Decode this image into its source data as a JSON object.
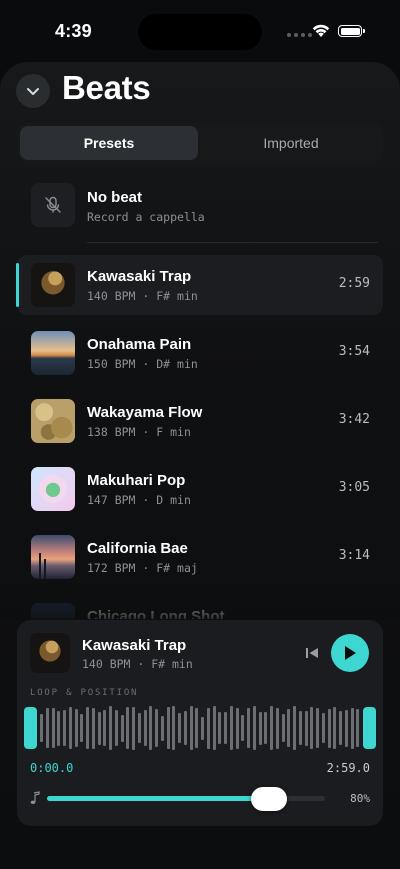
{
  "status_bar": {
    "time": "4:39"
  },
  "header": {
    "title": "Beats"
  },
  "tabs": [
    {
      "label": "Presets",
      "active": true
    },
    {
      "label": "Imported",
      "active": false
    }
  ],
  "no_beat": {
    "title": "No beat",
    "subtitle": "Record a cappella",
    "icon": "mic-off-icon"
  },
  "tracks": [
    {
      "title": "Kawasaki Trap",
      "bpm": "140 BPM",
      "key": "F# min",
      "duration": "2:59",
      "selected": true
    },
    {
      "title": "Onahama Pain",
      "bpm": "150 BPM",
      "key": "D# min",
      "duration": "3:54",
      "selected": false
    },
    {
      "title": "Wakayama Flow",
      "bpm": "138 BPM",
      "key": "F min",
      "duration": "3:42",
      "selected": false
    },
    {
      "title": "Makuhari Pop",
      "bpm": "147 BPM",
      "key": "D min",
      "duration": "3:05",
      "selected": false
    },
    {
      "title": "California Bae",
      "bpm": "172 BPM",
      "key": "F# maj",
      "duration": "3:14",
      "selected": false
    },
    {
      "title": "Chicago Long Shot",
      "bpm": "",
      "key": "",
      "duration": "",
      "selected": false
    }
  ],
  "player": {
    "title": "Kawasaki Trap",
    "subtitle": "140 BPM · F# min",
    "section_label": "LOOP & POSITION",
    "start_time": "0:00.0",
    "end_time": "2:59.0",
    "volume": 0.8,
    "volume_label": "80%"
  },
  "colors": {
    "accent": "#3dd6d0",
    "background": "#0c0d0e",
    "card": "#1a1c1f"
  }
}
